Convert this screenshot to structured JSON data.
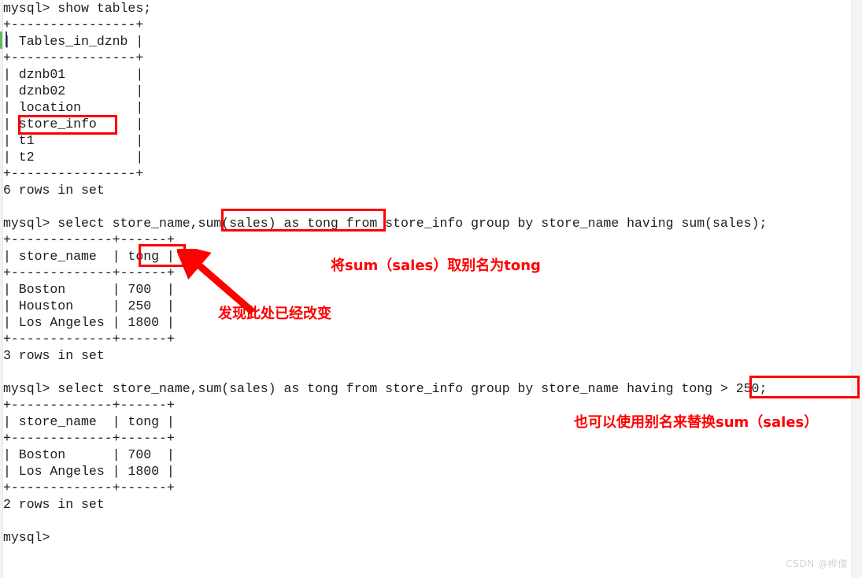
{
  "terminal": {
    "lines": [
      "mysql> show tables;",
      "+----------------+",
      "| Tables_in_dznb |",
      "+----------------+",
      "| dznb01         |",
      "| dznb02         |",
      "| location       |",
      "| store_info     |",
      "| t1             |",
      "| t2             |",
      "+----------------+",
      "6 rows in set",
      "",
      "mysql> select store_name,sum(sales) as tong from store_info group by store_name having sum(sales);",
      "+-------------+------+",
      "| store_name  | tong |",
      "+-------------+------+",
      "| Boston      | 700  |",
      "| Houston     | 250  |",
      "| Los Angeles | 1800 |",
      "+-------------+------+",
      "3 rows in set",
      "",
      "mysql> select store_name,sum(sales) as tong from store_info group by store_name having tong > 250;",
      "+-------------+------+",
      "| store_name  | tong |",
      "+-------------+------+",
      "| Boston      | 700  |",
      "| Los Angeles | 1800 |",
      "+-------------+------+",
      "2 rows in set",
      "",
      "mysql>"
    ],
    "prompt": "mysql>",
    "queries": [
      "show tables;",
      "select store_name,sum(sales) as tong from store_info group by store_name having sum(sales);",
      "select store_name,sum(sales) as tong from store_info group by store_name having tong > 250;"
    ],
    "result_sets": [
      {
        "columns": [
          "Tables_in_dznb"
        ],
        "rows": [
          [
            "dznb01"
          ],
          [
            "dznb02"
          ],
          [
            "location"
          ],
          [
            "store_info"
          ],
          [
            "t1"
          ],
          [
            "t2"
          ]
        ],
        "footer": "6 rows in set"
      },
      {
        "columns": [
          "store_name",
          "tong"
        ],
        "rows": [
          [
            "Boston",
            "700"
          ],
          [
            "Houston",
            "250"
          ],
          [
            "Los Angeles",
            "1800"
          ]
        ],
        "footer": "3 rows in set"
      },
      {
        "columns": [
          "store_name",
          "tong"
        ],
        "rows": [
          [
            "Boston",
            "700"
          ],
          [
            "Los Angeles",
            "1800"
          ]
        ],
        "footer": "2 rows in set"
      }
    ]
  },
  "annotations": {
    "highlight_boxes": [
      {
        "id": "store-info-table",
        "label": "store_info"
      },
      {
        "id": "sum-sales-as-tong",
        "label": "sum(sales) as tong"
      },
      {
        "id": "tong-column-header",
        "label": "tong"
      },
      {
        "id": "tong-gt-250",
        "label": "tong > 250;"
      }
    ],
    "notes": [
      {
        "id": "alias-note",
        "text": "将sum（sales）取别名为tong"
      },
      {
        "id": "changed-note",
        "text": "发现此处已经改变"
      },
      {
        "id": "alias-replace-note",
        "text": "也可以使用别名来替换sum（sales）"
      }
    ],
    "arrow": {
      "id": "pointer-arrow",
      "from": "changed-note",
      "to": "tong-column-header"
    },
    "color": "#fe0000"
  },
  "watermark": {
    "text": "CSDN @桦傑"
  }
}
